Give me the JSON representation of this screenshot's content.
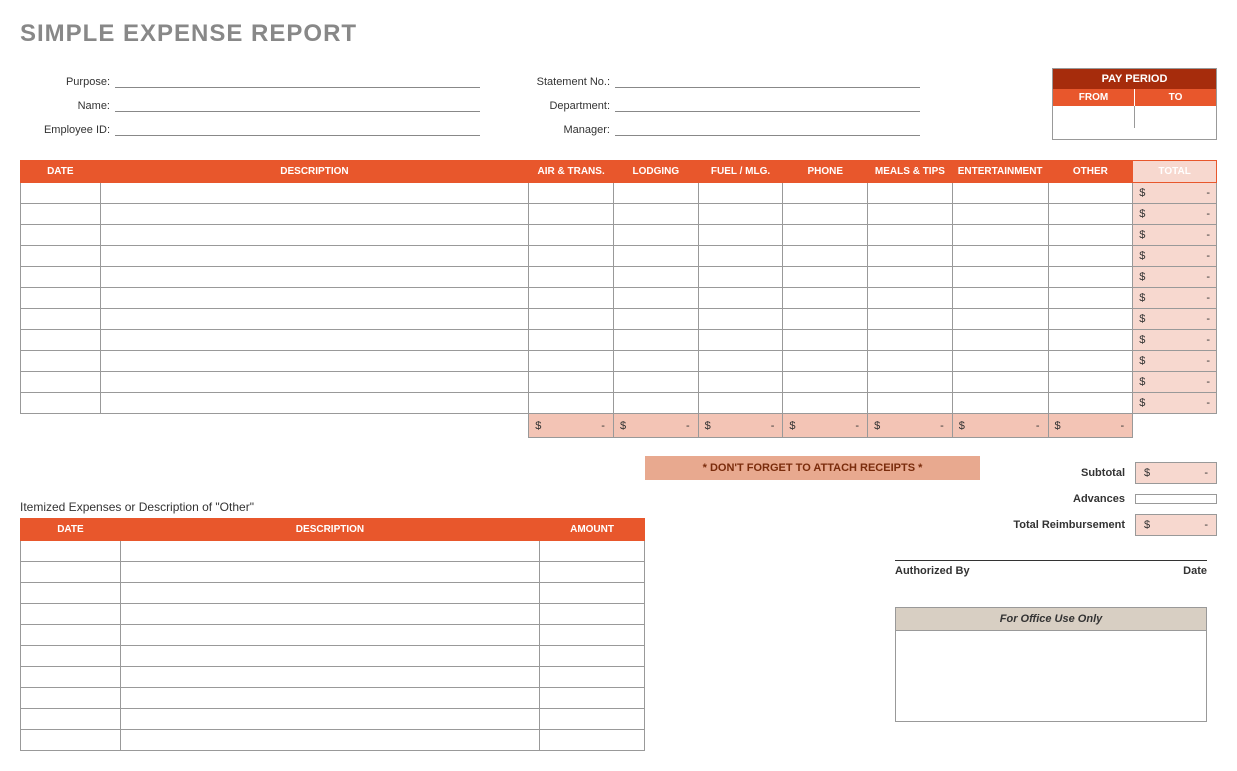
{
  "title": "SIMPLE EXPENSE REPORT",
  "header_fields_left": [
    {
      "label": "Purpose:"
    },
    {
      "label": "Name:"
    },
    {
      "label": "Employee ID:"
    }
  ],
  "header_fields_mid": [
    {
      "label": "Statement No.:"
    },
    {
      "label": "Department:"
    },
    {
      "label": "Manager:"
    }
  ],
  "pay_period": {
    "title": "PAY PERIOD",
    "from": "FROM",
    "to": "TO"
  },
  "main_columns": [
    "DATE",
    "DESCRIPTION",
    "AIR & TRANS.",
    "LODGING",
    "FUEL / MLG.",
    "PHONE",
    "MEALS & TIPS",
    "ENTERTAINMENT",
    "OTHER",
    "TOTAL"
  ],
  "main_rows_count": 11,
  "total_placeholder": {
    "currency": "$",
    "dash": "-"
  },
  "subtotal_cols": 7,
  "summary": {
    "subtotal": "Subtotal",
    "advances": "Advances",
    "total_reimb": "Total Reimbursement"
  },
  "receipts_note": "* DON'T FORGET TO ATTACH RECEIPTS *",
  "itemized_title": "Itemized Expenses or Description of \"Other\"",
  "itemized_columns": [
    "DATE",
    "DESCRIPTION",
    "AMOUNT"
  ],
  "itemized_rows_count": 10,
  "signature": {
    "by": "Authorized By",
    "date": "Date"
  },
  "office_use": "For Office Use Only"
}
